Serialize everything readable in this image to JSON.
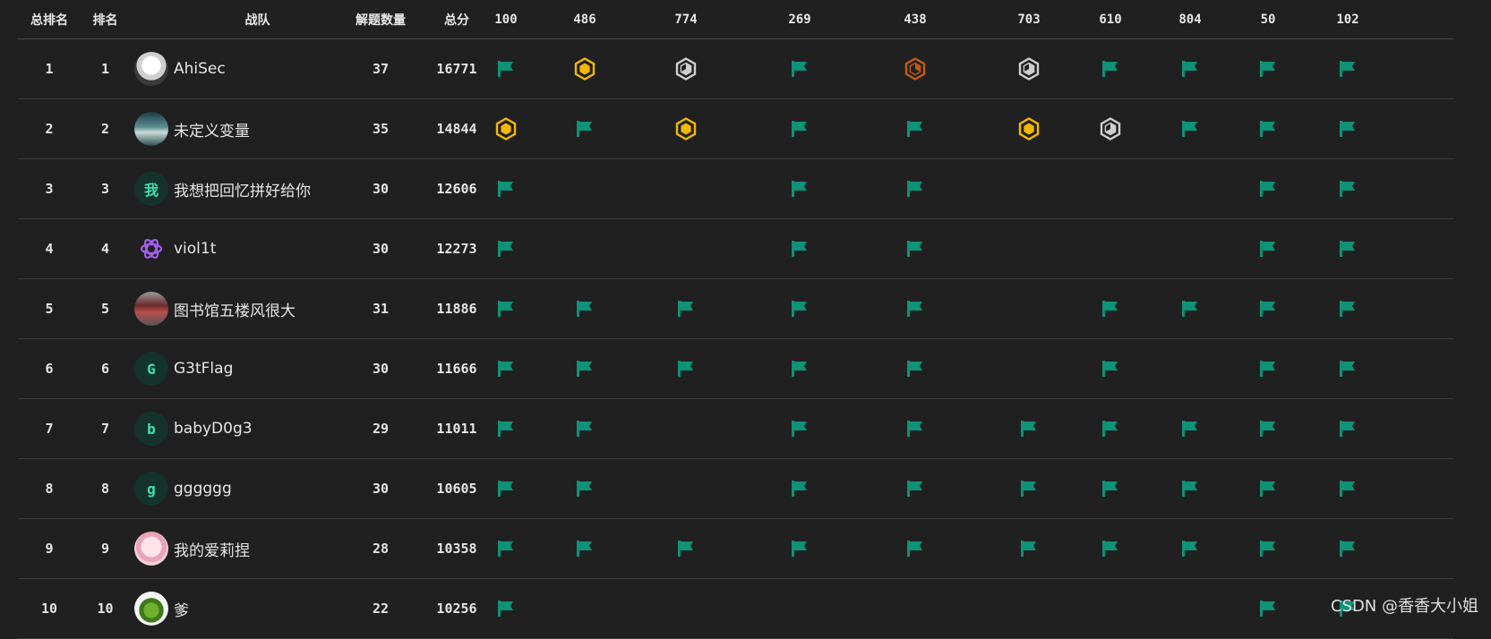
{
  "header": {
    "overall_rank": "总排名",
    "rank": "排名",
    "team": "战队",
    "solved": "解题数量",
    "score": "总分",
    "challenges": [
      "100",
      "486",
      "774",
      "269",
      "438",
      "703",
      "610",
      "804",
      "50",
      "102"
    ]
  },
  "colors": {
    "flag": "#0e9278",
    "gold": "#f5b800",
    "silver": "#cfcfcf",
    "bronze": "#c45a1a",
    "avatar_letter": "#3fe0b0"
  },
  "rows": [
    {
      "overall_rank": "1",
      "rank": "1",
      "team": "AhiSec",
      "avatar": "img1",
      "solved": "37",
      "score": "16771",
      "cells": [
        "flag",
        "gold",
        "silver",
        "flag",
        "bronze",
        "silver",
        "flag",
        "flag",
        "flag",
        "flag"
      ]
    },
    {
      "overall_rank": "2",
      "rank": "2",
      "team": "未定义变量",
      "avatar": "img2",
      "solved": "35",
      "score": "14844",
      "cells": [
        "gold",
        "flag",
        "gold",
        "flag",
        "flag",
        "gold",
        "silver",
        "flag",
        "flag",
        "flag"
      ]
    },
    {
      "overall_rank": "3",
      "rank": "3",
      "team": "我想把回忆拼好给你",
      "avatar": "letter",
      "avatar_letter": "我",
      "solved": "30",
      "score": "12606",
      "cells": [
        "flag",
        "",
        "",
        "flag",
        "flag",
        "",
        "",
        "",
        "flag",
        "flag"
      ]
    },
    {
      "overall_rank": "4",
      "rank": "4",
      "team": "viol1t",
      "avatar": "gear",
      "solved": "30",
      "score": "12273",
      "cells": [
        "flag",
        "",
        "",
        "flag",
        "flag",
        "",
        "",
        "",
        "flag",
        "flag"
      ]
    },
    {
      "overall_rank": "5",
      "rank": "5",
      "team": "图书馆五楼风很大",
      "avatar": "img5",
      "solved": "31",
      "score": "11886",
      "cells": [
        "flag",
        "flag",
        "flag",
        "flag",
        "flag",
        "",
        "flag",
        "flag",
        "flag",
        "flag"
      ]
    },
    {
      "overall_rank": "6",
      "rank": "6",
      "team": "G3tFlag",
      "avatar": "letter",
      "avatar_letter": "G",
      "solved": "30",
      "score": "11666",
      "cells": [
        "flag",
        "flag",
        "flag",
        "flag",
        "flag",
        "",
        "flag",
        "",
        "flag",
        "flag"
      ]
    },
    {
      "overall_rank": "7",
      "rank": "7",
      "team": "babyD0g3",
      "avatar": "letter",
      "avatar_letter": "b",
      "solved": "29",
      "score": "11011",
      "cells": [
        "flag",
        "flag",
        "",
        "flag",
        "flag",
        "flag",
        "flag",
        "flag",
        "flag",
        "flag"
      ]
    },
    {
      "overall_rank": "8",
      "rank": "8",
      "team": "gggggg",
      "avatar": "letter",
      "avatar_letter": "g",
      "solved": "30",
      "score": "10605",
      "cells": [
        "flag",
        "flag",
        "",
        "flag",
        "flag",
        "flag",
        "flag",
        "flag",
        "flag",
        "flag"
      ]
    },
    {
      "overall_rank": "9",
      "rank": "9",
      "team": "我的爱莉捏",
      "avatar": "img9",
      "solved": "28",
      "score": "10358",
      "cells": [
        "flag",
        "flag",
        "flag",
        "flag",
        "flag",
        "flag",
        "flag",
        "flag",
        "flag",
        "flag"
      ]
    },
    {
      "overall_rank": "10",
      "rank": "10",
      "team": "爹",
      "avatar": "img10",
      "solved": "22",
      "score": "10256",
      "cells": [
        "flag",
        "",
        "",
        "",
        "",
        "",
        "",
        "",
        "flag",
        "flag"
      ]
    }
  ],
  "watermark": "CSDN @香香大小姐"
}
